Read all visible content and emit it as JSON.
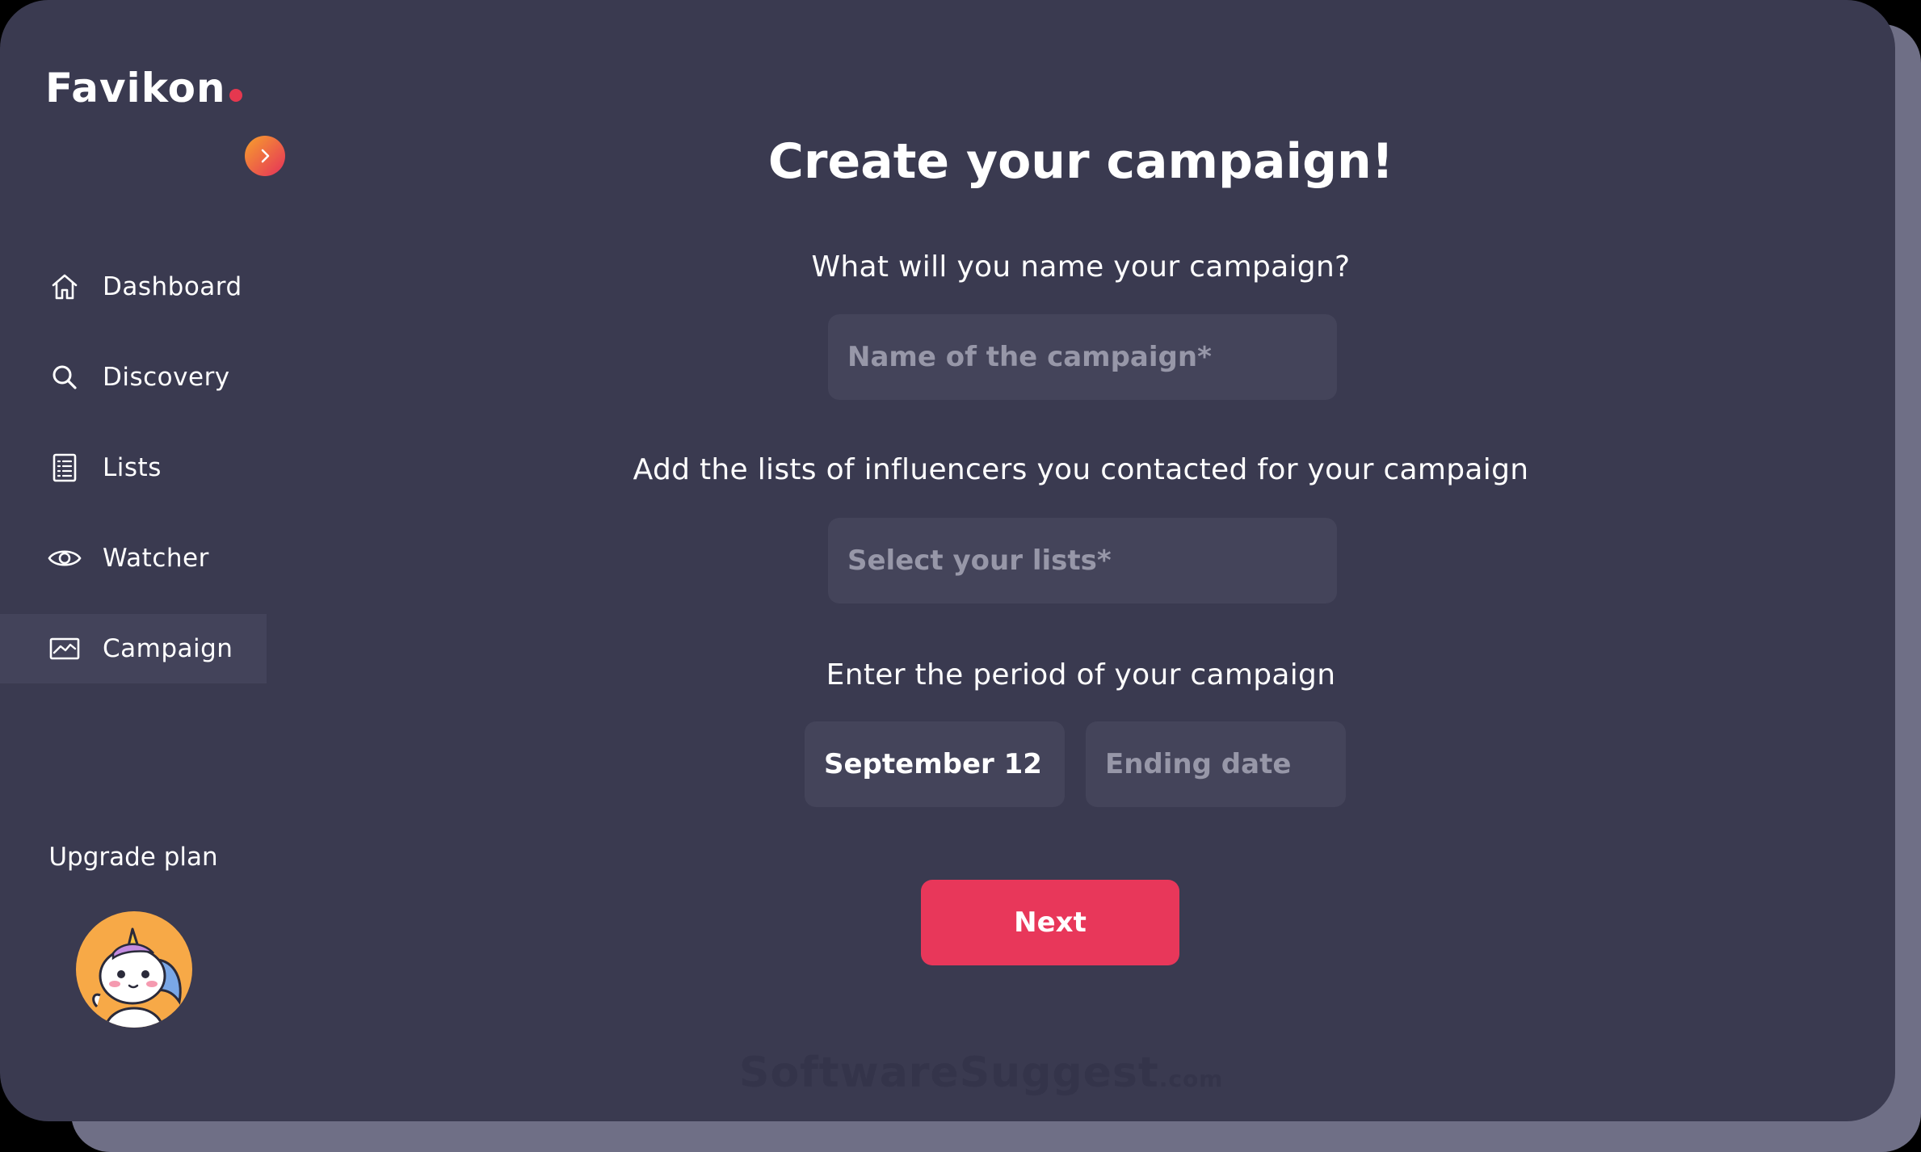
{
  "app": {
    "logo_text": "Favikon",
    "brand_color": "#e5384f"
  },
  "sidebar": {
    "items": [
      {
        "label": "Dashboard",
        "icon": "home-icon"
      },
      {
        "label": "Discovery",
        "icon": "search-icon"
      },
      {
        "label": "Lists",
        "icon": "list-icon"
      },
      {
        "label": "Watcher",
        "icon": "eye-icon"
      },
      {
        "label": "Campaign",
        "icon": "chart-icon",
        "active": true
      }
    ],
    "upgrade_label": "Upgrade plan"
  },
  "main": {
    "title": "Create your campaign!",
    "name_question": "What will you name your campaign?",
    "name_placeholder": "Name of the campaign*",
    "lists_question": "Add the lists of influencers you contacted for your campaign",
    "lists_placeholder": "Select your lists*",
    "period_question": "Enter the period of your campaign",
    "start_date": "September 12",
    "end_date_placeholder": "Ending date",
    "next_label": "Next",
    "next_color": "#e8375a"
  },
  "watermark": {
    "text": "SoftwareSuggest",
    "suffix": ".com"
  }
}
